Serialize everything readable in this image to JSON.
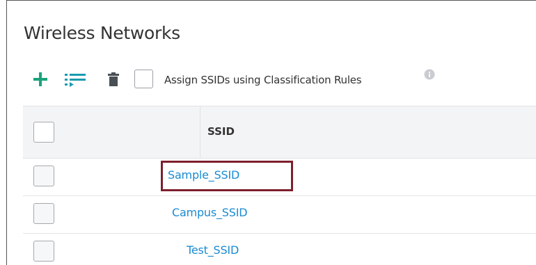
{
  "page": {
    "title": "Wireless Networks"
  },
  "toolbar": {
    "add_icon": "plus-icon",
    "list_icon": "list-arrow-icon",
    "delete_icon": "trash-icon",
    "assign_label": "Assign SSIDs using Classification Rules",
    "info_icon": "info-icon",
    "assign_checked": false
  },
  "table": {
    "columns": [
      {
        "label": "SSID"
      }
    ],
    "rows": [
      {
        "ssid": "Sample_SSID",
        "highlighted": true
      },
      {
        "ssid": "Campus_SSID",
        "highlighted": false
      },
      {
        "ssid": "Test_SSID",
        "highlighted": false
      }
    ]
  },
  "colors": {
    "accent": "#1aa37a",
    "link": "#1a8bd0",
    "highlight_border": "#7d1f2d",
    "header_bg": "#f3f4f5"
  }
}
